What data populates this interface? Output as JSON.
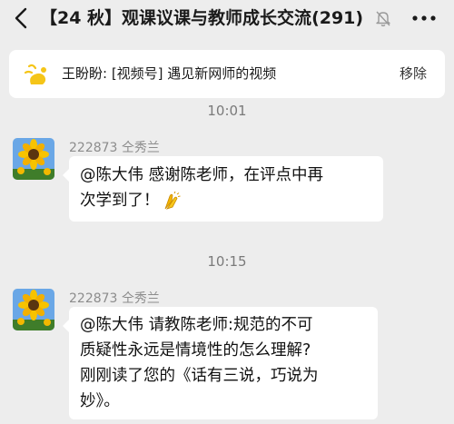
{
  "header": {
    "title": "【24 秋】观课议课与教师成长交流",
    "member_count": "(291)",
    "back_icon": "chevron-left-icon",
    "mute_icon": "bell-off-icon",
    "more_icon": "more-dots-icon"
  },
  "pinned": {
    "text": "王盼盼: [视频号] 遇见新网师的视频",
    "remove_label": "移除",
    "icon": "video-channel-icon"
  },
  "messages": [
    {
      "time": "10:01",
      "sender": "222873 仝秀兰",
      "lines": [
        "@陈大伟 感谢陈老师，在评点中再",
        "次学到了！"
      ],
      "trailing_emoji": "clap-icon"
    },
    {
      "time": "10:15",
      "sender": "222873 仝秀兰",
      "lines": [
        "@陈大伟 请教陈老师:规范的不可",
        "质疑性永远是情境性的怎么理解?",
        "刚刚读了您的《话有三说，巧说为",
        "妙》。"
      ]
    }
  ],
  "colors": {
    "background": "#ededed",
    "bubble": "#ffffff",
    "accent_yellow": "#f5c518"
  }
}
